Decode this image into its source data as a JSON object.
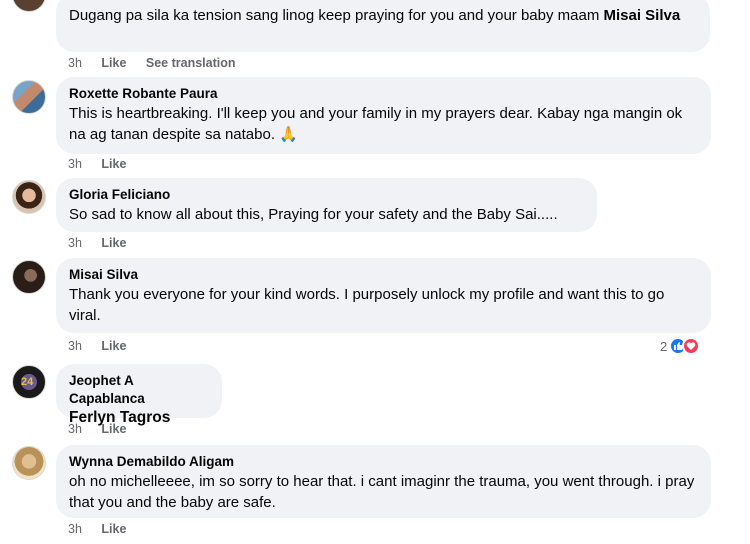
{
  "comments": [
    {
      "text_pre": "Dugang pa sila ka tension sang linog keep praying for you and your baby maam ",
      "text_tag": "Misai Silva",
      "time": "3h",
      "like": "Like",
      "translation": "See translation"
    },
    {
      "author": "Roxette Robante Paura",
      "text": "This is heartbreaking. I'll keep you and your family in my prayers dear. Kabay nga mangin ok na ag tanan despite sa natabo. 🙏",
      "time": "3h",
      "like": "Like"
    },
    {
      "author": "Gloria Feliciano",
      "text": "So sad to know all about this, Praying for your safety and the Baby Sai.....",
      "time": "3h",
      "like": "Like"
    },
    {
      "author": "Misai Silva",
      "text": "Thank you everyone for your kind words. I purposely unlock my profile and want this to go viral.",
      "time": "3h",
      "like": "Like",
      "reaction_count": "2"
    },
    {
      "author": "Jeophet A Capablanca",
      "tag": "Ferlyn Tagros",
      "time": "3h",
      "like": "Like"
    },
    {
      "author": "Wynna Demabildo Aligam",
      "text": "oh no michelleeee, im so sorry to hear that. i cant imaginr the trauma, you went through. i pray that you and the baby are safe.",
      "time": "3h",
      "like": "Like"
    }
  ],
  "colors": {
    "bubble": "#f0f2f5",
    "meta": "#65676b",
    "like_reaction": "#1877f2",
    "love_reaction": "#f33e58"
  },
  "icons": [
    "avatar",
    "like-reaction-icon",
    "love-reaction-icon",
    "pray-emoji"
  ]
}
